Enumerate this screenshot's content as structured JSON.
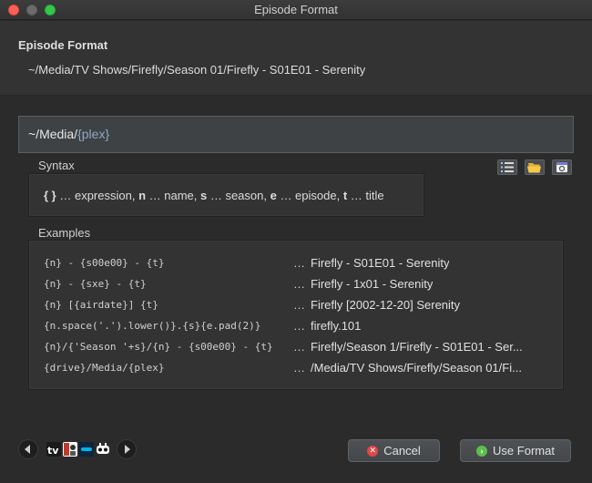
{
  "window": {
    "title": "Episode Format"
  },
  "header": {
    "title": "Episode Format",
    "preview": "~/Media/TV Shows/Firefly/Season 01/Firefly - S01E01 - Serenity"
  },
  "format": {
    "prefix": "~/Media/",
    "expression": "{plex}"
  },
  "syntax": {
    "label": "Syntax",
    "items": [
      {
        "key": "{ }",
        "desc": " … expression, "
      },
      {
        "key": "n",
        "desc": " … name, "
      },
      {
        "key": "s",
        "desc": " … season, "
      },
      {
        "key": "e",
        "desc": " … episode, "
      },
      {
        "key": "t",
        "desc": " … title"
      }
    ]
  },
  "examples": {
    "label": "Examples",
    "rows": [
      {
        "code": "{n} - {s00e00} - {t}",
        "dots": "…",
        "result": "Firefly - S01E01 - Serenity"
      },
      {
        "code": "{n} - {sxe} - {t}",
        "dots": "…",
        "result": "Firefly - 1x01 - Serenity"
      },
      {
        "code": "{n} [{airdate}] {t}",
        "dots": "…",
        "result": "Firefly [2002-12-20] Serenity"
      },
      {
        "code": "{n.space('.').lower()}.{s}{e.pad(2)}",
        "dots": "…",
        "result": "firefly.101"
      },
      {
        "code": "{n}/{'Season '+s}/{n} - {s00e00} - {t}",
        "dots": "…",
        "result": "Firefly/Season 1/Firefly - S01E01 - Ser..."
      },
      {
        "code": "{drive}/Media/{plex}",
        "dots": "…",
        "result": "/Media/TV Shows/Firefly/Season 01/Fi..."
      }
    ]
  },
  "buttons": {
    "cancel": "Cancel",
    "use_format": "Use Format"
  },
  "colors": {
    "accent_expression": "#8fa8c4",
    "cancel_icon": "#e04848",
    "ok_icon": "#5cbf4a"
  }
}
